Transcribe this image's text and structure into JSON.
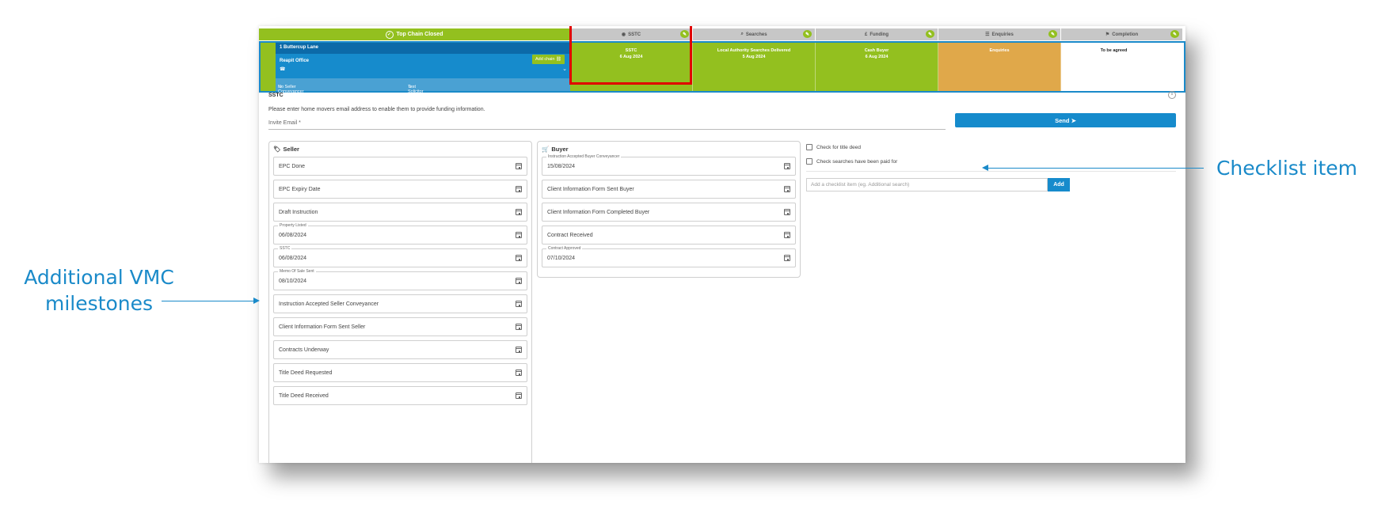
{
  "stages": {
    "top": "Top Chain Closed",
    "items": [
      "SSTC",
      "Searches",
      "Funding",
      "Enquiries",
      "Completion"
    ],
    "icons": [
      "eye-icon",
      "search-icon",
      "pound-icon",
      "list-icon",
      "flag-icon"
    ]
  },
  "chain": {
    "address": "1 Buttercup Lane",
    "office": "Reapit Office",
    "phone": "☎",
    "add_chain": "Add chain",
    "seller_conveyancer": "No Seller Conveyancer",
    "buyer_solicitor": "Test Solicitor",
    "cells": [
      {
        "title": "SSTC",
        "date": "6 Aug 2024",
        "color": "#93c01f"
      },
      {
        "title": "Local Authority Searches Delivered",
        "date": "5 Aug 2024",
        "color": "#93c01f"
      },
      {
        "title": "Cash Buyer",
        "date": "6 Aug 2024",
        "color": "#93c01f"
      },
      {
        "title": "Enquiries",
        "date": "",
        "color": "#e0a84a"
      },
      {
        "title": "To be agreed",
        "date": "",
        "color": "#ffffff"
      }
    ]
  },
  "panel": {
    "title": "SSTC",
    "info": "Please enter home movers email address to enable them to provide funding information.",
    "invite_label": "Invite Email *",
    "send": "Send"
  },
  "seller": {
    "title": "Seller",
    "fields": [
      {
        "label": "",
        "value": "EPC Done"
      },
      {
        "label": "",
        "value": "EPC Expiry Date"
      },
      {
        "label": "",
        "value": "Draft Instruction"
      },
      {
        "label": "Property Listed",
        "value": "06/08/2024"
      },
      {
        "label": "SSTC",
        "value": "06/08/2024"
      },
      {
        "label": "Memo Of Sale Sent",
        "value": "08/10/2024"
      },
      {
        "label": "",
        "value": "Instruction Accepted Seller Conveyancer"
      },
      {
        "label": "",
        "value": "Client Information Form Sent Seller"
      },
      {
        "label": "",
        "value": "Contracts Underway"
      },
      {
        "label": "",
        "value": "Title Deed Requested"
      },
      {
        "label": "",
        "value": "Title Deed Received"
      }
    ]
  },
  "buyer": {
    "title": "Buyer",
    "fields": [
      {
        "label": "Instruction Accepted Buyer Conveyancer",
        "value": "15/08/2024"
      },
      {
        "label": "",
        "value": "Client Information Form Sent Buyer"
      },
      {
        "label": "",
        "value": "Client Information Form Completed Buyer"
      },
      {
        "label": "",
        "value": "Contract Received"
      },
      {
        "label": "Contract Approved",
        "value": "07/10/2024"
      }
    ]
  },
  "checklist": {
    "items": [
      "Check for title deed",
      "Check searches have been paid for"
    ],
    "placeholder": "Add a checklist item (eg. Additional search)",
    "add": "Add"
  },
  "annotations": {
    "left_line1": "Additional VMC",
    "left_line2": "milestones",
    "right": "Checklist item"
  },
  "colors": {
    "accent": "#1a8ac9",
    "green": "#93c01f",
    "orange": "#e0a84a",
    "highlight": "#e10000"
  }
}
